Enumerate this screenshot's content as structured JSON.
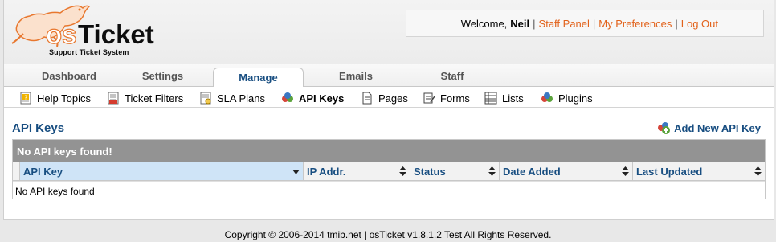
{
  "logo": {
    "name": "osTicket",
    "tagline": "Support Ticket System"
  },
  "userinfo": {
    "welcome": "Welcome,",
    "username": "Neil",
    "links": [
      "Staff Panel",
      "My Preferences",
      "Log Out"
    ]
  },
  "nav": {
    "tabs": [
      "Dashboard",
      "Settings",
      "Manage",
      "Emails",
      "Staff"
    ],
    "active": "Manage"
  },
  "subnav": {
    "items": [
      {
        "label": "Help Topics",
        "icon": "help-topics-icon"
      },
      {
        "label": "Ticket Filters",
        "icon": "ticket-filters-icon"
      },
      {
        "label": "SLA Plans",
        "icon": "sla-plans-icon"
      },
      {
        "label": "API Keys",
        "icon": "api-keys-icon"
      },
      {
        "label": "Pages",
        "icon": "pages-icon"
      },
      {
        "label": "Forms",
        "icon": "forms-icon"
      },
      {
        "label": "Lists",
        "icon": "lists-icon"
      },
      {
        "label": "Plugins",
        "icon": "plugins-icon"
      }
    ],
    "active": "API Keys"
  },
  "page": {
    "title": "API Keys",
    "add_link": "Add New API Key",
    "caption": "No API keys found!",
    "columns": [
      "API Key",
      "IP Addr.",
      "Status",
      "Date Added",
      "Last Updated"
    ],
    "empty_message": "No API keys found"
  },
  "footer": "Copyright © 2006-2014 tmib.net | osTicket v1.8.1.2 Test All Rights Reserved.",
  "colors": {
    "accent": "#184e81",
    "link": "#e2621b",
    "caption_bg": "#939393",
    "selected_header": "#cfe4f7"
  }
}
